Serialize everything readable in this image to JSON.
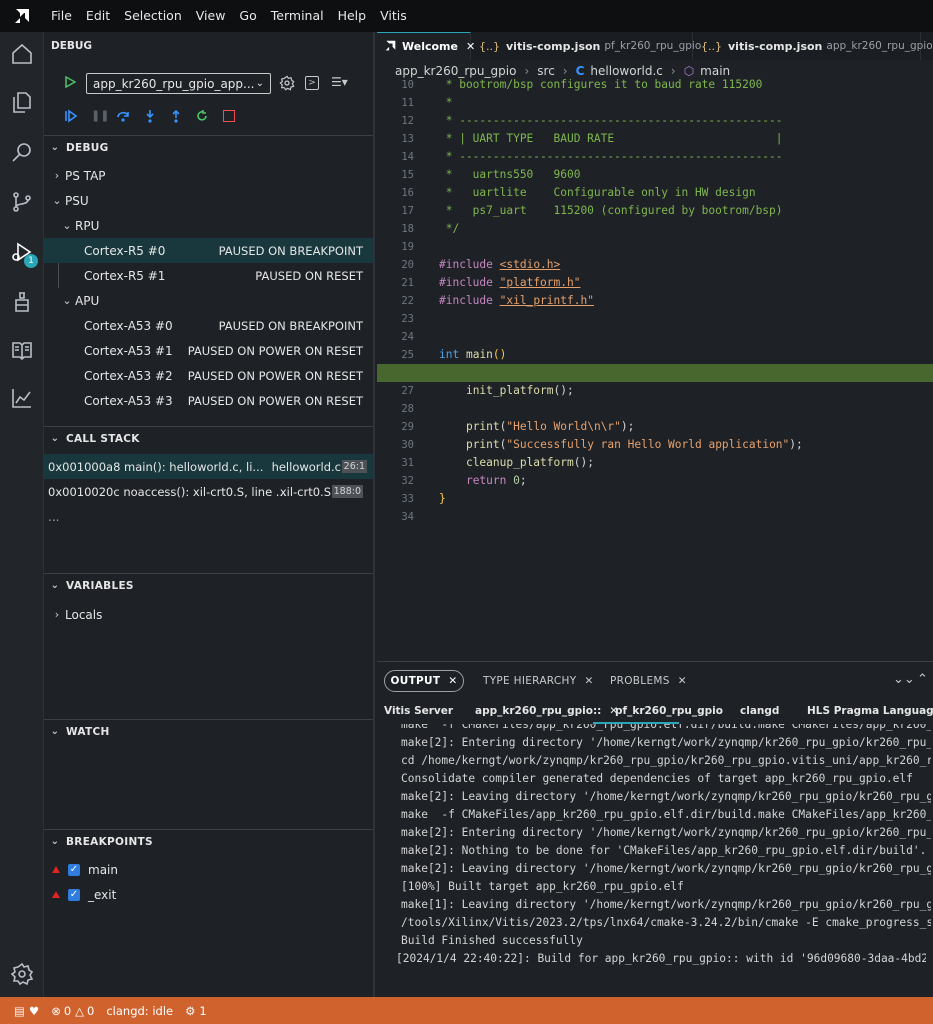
{
  "menubar": {
    "items": [
      "File",
      "Edit",
      "Selection",
      "View",
      "Go",
      "Terminal",
      "Help",
      "Vitis"
    ]
  },
  "activity": {
    "debug_badge": "1"
  },
  "debug_panel": {
    "title": "DEBUG",
    "config": "app_kr260_rpu_gpio_app...",
    "debug_section": "DEBUG",
    "tree": {
      "ps_tap": "PS TAP",
      "psu": "PSU",
      "rpu": "RPU",
      "r5_0": {
        "name": "Cortex-R5 #0",
        "state": "PAUSED ON BREAKPOINT"
      },
      "r5_1": {
        "name": "Cortex-R5 #1",
        "state": "PAUSED ON RESET"
      },
      "apu": "APU",
      "a53_0": {
        "name": "Cortex-A53 #0",
        "state": "PAUSED ON BREAKPOINT"
      },
      "a53_1": {
        "name": "Cortex-A53 #1",
        "state": "PAUSED ON POWER ON RESET"
      },
      "a53_2": {
        "name": "Cortex-A53 #2",
        "state": "PAUSED ON POWER ON RESET"
      },
      "a53_3": {
        "name": "Cortex-A53 #3",
        "state": "PAUSED ON POWER ON RESET"
      }
    },
    "call_stack_title": "CALL STACK",
    "call_stack": [
      {
        "frame": "0x001000a8 main(): helloworld.c, li...",
        "file": "helloworld.c",
        "pos": "26:1"
      },
      {
        "frame": "0x0010020c noaccess(): xil-crt0.S, line ...",
        "file": "xil-crt0.S",
        "pos": "188:0"
      }
    ],
    "call_stack_more": "...",
    "variables_title": "VARIABLES",
    "locals": "Locals",
    "watch_title": "WATCH",
    "breakpoints_title": "BREAKPOINTS",
    "breakpoints": [
      "main",
      "_exit"
    ]
  },
  "editor": {
    "tabs": [
      {
        "label": "Welcome",
        "sub": ""
      },
      {
        "label": "vitis-comp.json",
        "sub": "pf_kr260_rpu_gpio"
      },
      {
        "label": "vitis-comp.json",
        "sub": "app_kr260_rpu_gpio"
      }
    ],
    "breadcrumb": [
      "app_kr260_rpu_gpio",
      "src",
      "helloworld.c",
      "main"
    ],
    "current_line": 26
  },
  "panel": {
    "tabs": [
      "OUTPUT",
      "TYPE HIERARCHY",
      "PROBLEMS"
    ],
    "channels": [
      "Vitis Server",
      "app_kr260_rpu_gpio::",
      "pf_kr260_rpu_gpio",
      "clangd",
      "HLS Pragma Language S"
    ],
    "output_lines": [
      "make  -f CMakeFiles/app_kr260_rpu_gpio.elf.dir/build.make CMakeFiles/app_kr260_rpu_gpio",
      "make[2]: Entering directory '/home/kerngt/work/zynqmp/kr260_rpu_gpio/kr260_rpu_gpio",
      "cd /home/kerngt/work/zynqmp/kr260_rpu_gpio/kr260_rpu_gpio.vitis_uni/app_kr260_rpu",
      "Consolidate compiler generated dependencies of target app_kr260_rpu_gpio.elf",
      "make[2]: Leaving directory '/home/kerngt/work/zynqmp/kr260_rpu_gpio/kr260_rpu_gpio",
      "make  -f CMakeFiles/app_kr260_rpu_gpio.elf.dir/build.make CMakeFiles/app_kr260_rpu",
      "make[2]: Entering directory '/home/kerngt/work/zynqmp/kr260_rpu_gpio/kr260_rpu_gpio",
      "make[2]: Nothing to be done for 'CMakeFiles/app_kr260_rpu_gpio.elf.dir/build'.",
      "make[2]: Leaving directory '/home/kerngt/work/zynqmp/kr260_rpu_gpio/kr260_rpu_gpio",
      "[100%] Built target app_kr260_rpu_gpio.elf",
      "make[1]: Leaving directory '/home/kerngt/work/zynqmp/kr260_rpu_gpio/kr260_rpu_gpio",
      "/tools/Xilinx/Vitis/2023.2/tps/lnx64/cmake-3.24.2/bin/cmake -E cmake_progress_st",
      "Build Finished successfully"
    ],
    "last_line": "[2024/1/4 22:40:22]: Build for app_kr260_rpu_gpio:: with id '96d09680-3daa-4bd2-a"
  },
  "status": {
    "errors": "0",
    "warnings": "0",
    "clangd": "clangd: idle",
    "ports": "1"
  }
}
